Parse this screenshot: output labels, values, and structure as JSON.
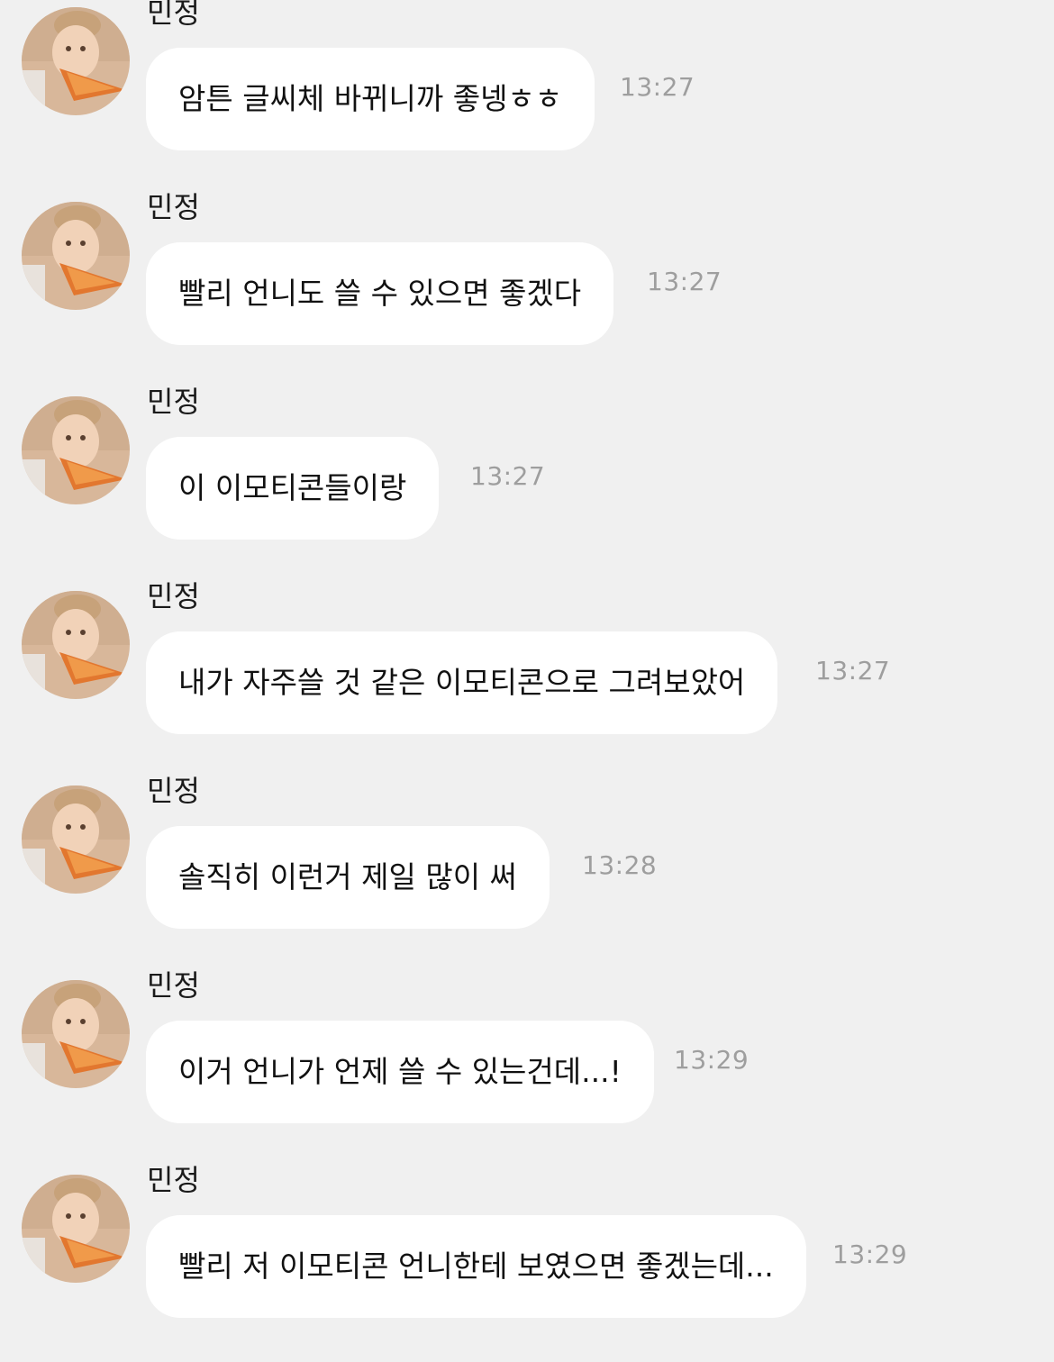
{
  "chat": {
    "messages": [
      {
        "sender": "민정",
        "text": "암튼 글씨체 바뀌니까 좋넹ㅎㅎ",
        "time": "13:27",
        "avatar": "avatar-photo"
      },
      {
        "sender": "민정",
        "text": "빨리 언니도 쓸 수 있으면 좋겠다",
        "time": "13:27",
        "avatar": "avatar-photo"
      },
      {
        "sender": "민정",
        "text": "이 이모티콘들이랑",
        "time": "13:27",
        "avatar": "avatar-photo"
      },
      {
        "sender": "민정",
        "text": "내가 자주쓸 것 같은 이모티콘으로 그려보았어",
        "time": "13:27",
        "avatar": "avatar-photo"
      },
      {
        "sender": "민정",
        "text": "솔직히 이런거 제일 많이 써",
        "time": "13:28",
        "avatar": "avatar-photo"
      },
      {
        "sender": "민정",
        "text": "이거 언니가 언제 쓸 수 있는건데...!",
        "time": "13:29",
        "avatar": "avatar-photo"
      },
      {
        "sender": "민정",
        "text": "빨리 저 이모티콘 언니한테 보였으면 좋겠는데...",
        "time": "13:29",
        "avatar": "avatar-photo"
      }
    ]
  },
  "colors": {
    "background": "#f0f0f0",
    "bubble": "#ffffff",
    "timestamp": "#9e9e9e",
    "text": "#111111"
  }
}
